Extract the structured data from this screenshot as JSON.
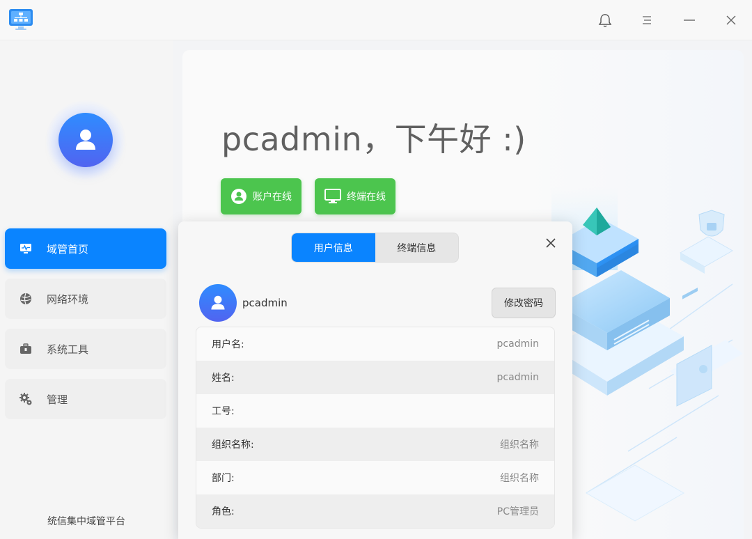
{
  "app": {
    "footer": "统信集中域管平台"
  },
  "titlebar": {
    "icons": [
      "bell-icon",
      "menu-icon",
      "minimize-icon",
      "close-icon"
    ]
  },
  "sidebar": {
    "items": [
      {
        "label": "域管首页",
        "icon": "dashboard-icon",
        "active": true
      },
      {
        "label": "网络环境",
        "icon": "globe-icon",
        "active": false
      },
      {
        "label": "系统工具",
        "icon": "toolbox-icon",
        "active": false
      },
      {
        "label": "管理",
        "icon": "gears-icon",
        "active": false
      }
    ]
  },
  "main": {
    "greeting": "pcadmin，下午好 :)",
    "status_buttons": [
      {
        "label": "账户在线",
        "icon": "user-circle-icon"
      },
      {
        "label": "终端在线",
        "icon": "monitor-icon"
      }
    ]
  },
  "modal": {
    "tabs": [
      {
        "label": "用户信息",
        "active": true
      },
      {
        "label": "终端信息",
        "active": false
      }
    ],
    "username": "pcadmin",
    "change_password_label": "修改密码",
    "rows": [
      {
        "key": "用户名:",
        "value": "pcadmin"
      },
      {
        "key": "姓名:",
        "value": "pcadmin"
      },
      {
        "key": "工号:",
        "value": ""
      },
      {
        "key": "组织名称:",
        "value": "组织名称"
      },
      {
        "key": "部门:",
        "value": "组织名称"
      },
      {
        "key": "角色:",
        "value": "PC管理员"
      }
    ]
  },
  "colors": {
    "accent": "#0a84ff",
    "online_green": "#4cc54e"
  }
}
